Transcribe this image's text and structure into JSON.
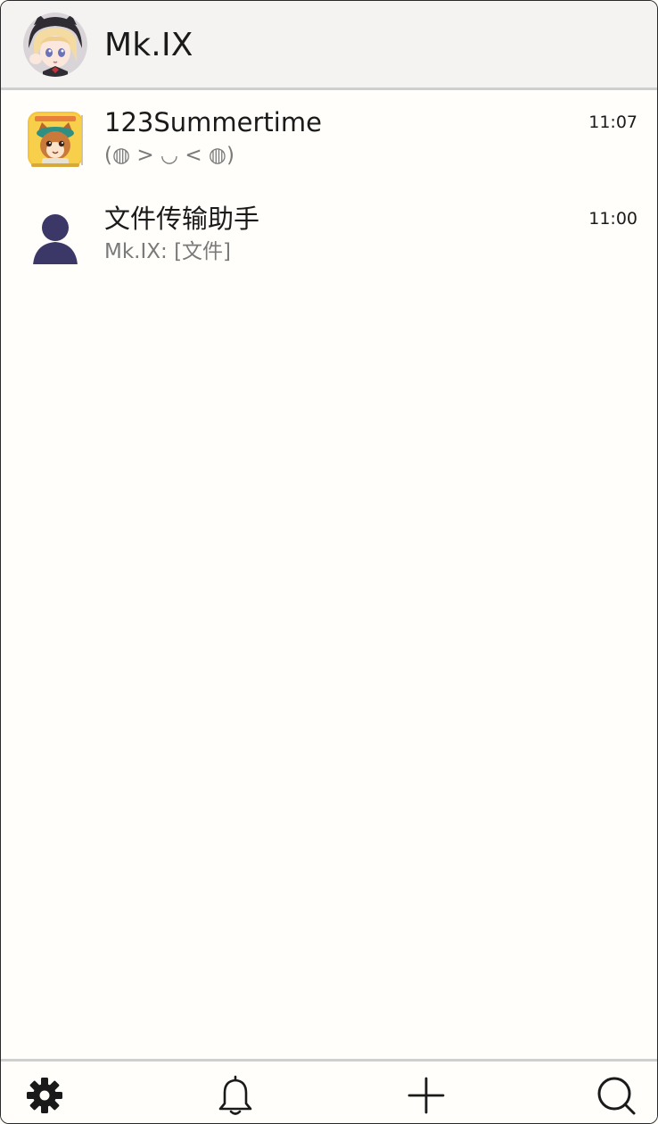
{
  "header": {
    "title": "Mk.IX",
    "avatar_icon": "user-avatar-anime"
  },
  "chats": [
    {
      "name": "123Summertime",
      "preview": "(◍ > ◡ < ◍)",
      "time": "11:07",
      "thumb_icon": "game-avatar-anime"
    },
    {
      "name": "文件传输助手",
      "preview": "Mk.IX: [文件]",
      "time": "11:00",
      "thumb_icon": "default-person-icon"
    }
  ],
  "bottom_bar": {
    "icons": [
      "gear-icon",
      "bell-icon",
      "plus-icon",
      "search-icon"
    ]
  },
  "colors": {
    "background": "#fffefa",
    "header_bg": "#f4f3f1",
    "divider": "#cfcfcf",
    "preview_text": "#7a7a7a",
    "person_icon": "#3b3766"
  }
}
